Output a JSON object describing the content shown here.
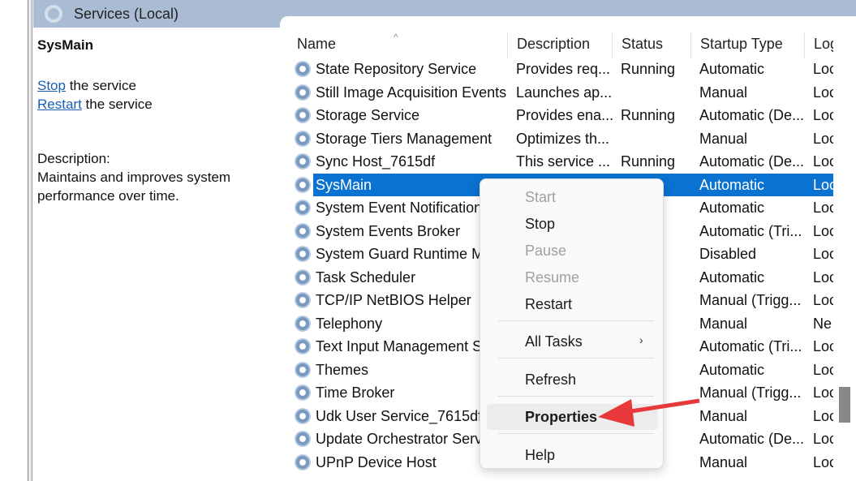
{
  "header": {
    "title": "Services (Local)"
  },
  "detail": {
    "name": "SysMain",
    "stop_link": "Stop",
    "stop_suffix": " the service",
    "restart_link": "Restart",
    "restart_suffix": " the service",
    "desc_label": "Description:",
    "desc_text": "Maintains and improves system performance over time."
  },
  "columns": [
    "Name",
    "Description",
    "Status",
    "Startup Type",
    "Log"
  ],
  "rows": [
    {
      "name": "State Repository Service",
      "desc": "Provides req...",
      "status": "Running",
      "startup": "Automatic",
      "logon": "Loc"
    },
    {
      "name": "Still Image Acquisition Events",
      "desc": "Launches ap...",
      "status": "",
      "startup": "Manual",
      "logon": "Loc"
    },
    {
      "name": "Storage Service",
      "desc": "Provides ena...",
      "status": "Running",
      "startup": "Automatic (De...",
      "logon": "Loc"
    },
    {
      "name": "Storage Tiers Management",
      "desc": "Optimizes th...",
      "status": "",
      "startup": "Manual",
      "logon": "Loc"
    },
    {
      "name": "Sync Host_7615df",
      "desc": "This service ...",
      "status": "Running",
      "startup": "Automatic (De...",
      "logon": "Loc"
    },
    {
      "name": "SysMain",
      "desc": "",
      "status": "ng",
      "startup": "Automatic",
      "logon": "Loc"
    },
    {
      "name": "System Event Notification",
      "desc": "",
      "status": "ng",
      "startup": "Automatic",
      "logon": "Loc"
    },
    {
      "name": "System Events Broker",
      "desc": "",
      "status": "ng",
      "startup": "Automatic (Tri...",
      "logon": "Loc"
    },
    {
      "name": "System Guard Runtime M",
      "desc": "",
      "status": "",
      "startup": "Disabled",
      "logon": "Loc"
    },
    {
      "name": "Task Scheduler",
      "desc": "",
      "status": "ng",
      "startup": "Automatic",
      "logon": "Loc"
    },
    {
      "name": "TCP/IP NetBIOS Helper",
      "desc": "",
      "status": "ng",
      "startup": "Manual (Trigg...",
      "logon": "Loc"
    },
    {
      "name": "Telephony",
      "desc": "",
      "status": "",
      "startup": "Manual",
      "logon": "Ne"
    },
    {
      "name": "Text Input Management S",
      "desc": "",
      "status": "ng",
      "startup": "Automatic (Tri...",
      "logon": "Loc"
    },
    {
      "name": "Themes",
      "desc": "",
      "status": "ng",
      "startup": "Automatic",
      "logon": "Loc"
    },
    {
      "name": "Time Broker",
      "desc": "",
      "status": "ng",
      "startup": "Manual (Trigg...",
      "logon": "Loc"
    },
    {
      "name": "Udk User Service_7615df",
      "desc": "",
      "status": "ng",
      "startup": "Manual",
      "logon": "Loc"
    },
    {
      "name": "Update Orchestrator Servi",
      "desc": "",
      "status": "ng",
      "startup": "Automatic (De...",
      "logon": "Loc"
    },
    {
      "name": "UPnP Device Host",
      "desc": "",
      "status": "",
      "startup": "Manual",
      "logon": "Loc"
    }
  ],
  "menu": {
    "start": "Start",
    "stop": "Stop",
    "pause": "Pause",
    "resume": "Resume",
    "restart": "Restart",
    "all_tasks": "All Tasks",
    "refresh": "Refresh",
    "properties": "Properties",
    "help": "Help",
    "chevron": "›"
  },
  "colors": {
    "selection": "#0a72d0",
    "arrow": "#e8383b",
    "header": "#aabcd3"
  }
}
